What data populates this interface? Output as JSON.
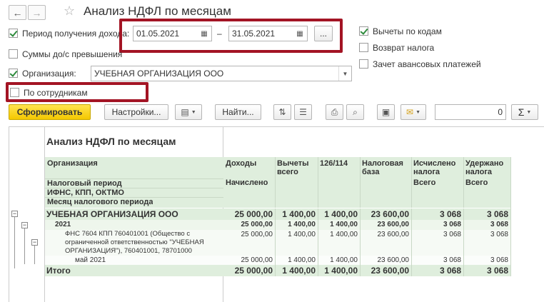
{
  "window": {
    "title": "Анализ НДФЛ по месяцам"
  },
  "form": {
    "period_label": "Период получения дохода:",
    "period_from": "01.05.2021",
    "period_dash": "–",
    "period_to": "31.05.2021",
    "ellipsis": "...",
    "sums_label": "Суммы до/с превышения",
    "org_label": "Организация:",
    "org_value": "УЧЕБНАЯ ОРГАНИЗАЦИЯ ООО",
    "employees_label": "По сотрудникам",
    "deductions_label": "Вычеты по кодам",
    "refund_label": "Возврат налога",
    "advance_label": "Зачет авансовых платежей"
  },
  "toolbar": {
    "generate": "Сформировать",
    "settings": "Настройки...",
    "find": "Найти...",
    "sum_value": "0",
    "sigma": "Σ"
  },
  "report": {
    "title": "Анализ НДФЛ по месяцам",
    "h_org": "Организация",
    "h_period": "Налоговый период",
    "h_ifns": "ИФНС, КПП, ОКТМО",
    "h_month": "Месяц налогового периода",
    "h_income": "Доходы",
    "h_accrued": "Начислено",
    "h_deduct": "Вычеты всего",
    "h_126": "126/114",
    "h_base": "Налоговая база",
    "h_calc": "Исчислено налога",
    "h_calc_sub": "Всего",
    "h_withheld": "Удержано налога",
    "h_withheld_sub": "Всего",
    "rows": [
      {
        "label": "УЧЕБНАЯ ОРГАНИЗАЦИЯ ООО",
        "v": [
          "25 000,00",
          "1 400,00",
          "1 400,00",
          "23 600,00",
          "3 068",
          "3 068"
        ]
      },
      {
        "label": "2021",
        "v": [
          "25 000,00",
          "1 400,00",
          "1 400,00",
          "23 600,00",
          "3 068",
          "3 068"
        ]
      },
      {
        "label1": "ФНС 7604 КПП 760401001 (Общество с",
        "label2": "ограниченной ответственностью \"УЧЕБНАЯ",
        "label3": "ОРГАНИЗАЦИЯ\"), 760401001, 78701000",
        "v": [
          "25 000,00",
          "1 400,00",
          "1 400,00",
          "23 600,00",
          "3 068",
          "3 068"
        ]
      },
      {
        "label": "май 2021",
        "v": [
          "25 000,00",
          "1 400,00",
          "1 400,00",
          "23 600,00",
          "3 068",
          "3 068"
        ]
      }
    ],
    "total_label": "Итого",
    "total": [
      "25 000,00",
      "1 400,00",
      "1 400,00",
      "23 600,00",
      "3 068",
      "3 068"
    ],
    "tree_minus": "−"
  }
}
